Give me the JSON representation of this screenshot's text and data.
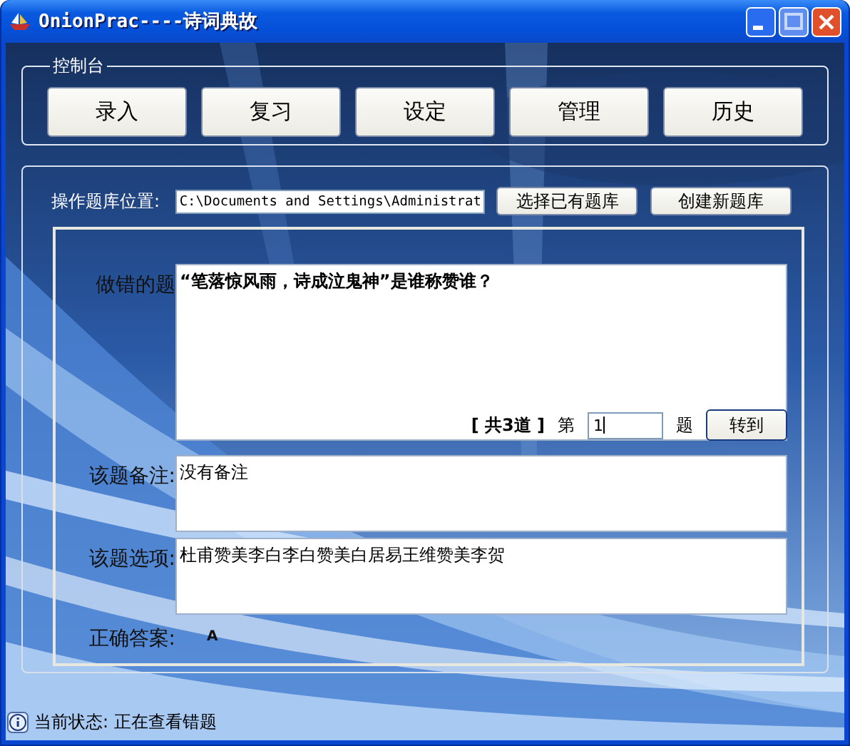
{
  "window": {
    "title": "OnionPrac----诗词典故"
  },
  "control_panel": {
    "title": "控制台",
    "buttons": [
      "录入",
      "复习",
      "设定",
      "管理",
      "历史"
    ]
  },
  "library": {
    "label": "操作题库位置:",
    "path": "C:\\Documents and Settings\\Administrat",
    "buttons": [
      "选择已有题库",
      "创建新题库"
    ]
  },
  "question": {
    "label": "做错的题",
    "text": "“笔落惊风雨，诗成泣鬼神”是谁称赞谁？",
    "total": "[ 共3道 ]",
    "prefix": "第",
    "number": "1",
    "suffix": "题",
    "go_button": "转到"
  },
  "note": {
    "label": "该题备注:",
    "text": "没有备注"
  },
  "options": {
    "label": "该题选项:",
    "text": "杜甫赞美李白李白赞美白居易王维赞美李贺"
  },
  "answer": {
    "label": "正确答案:",
    "text": "A"
  },
  "status_bar": {
    "text": "当前状态: 正在查看错题"
  }
}
